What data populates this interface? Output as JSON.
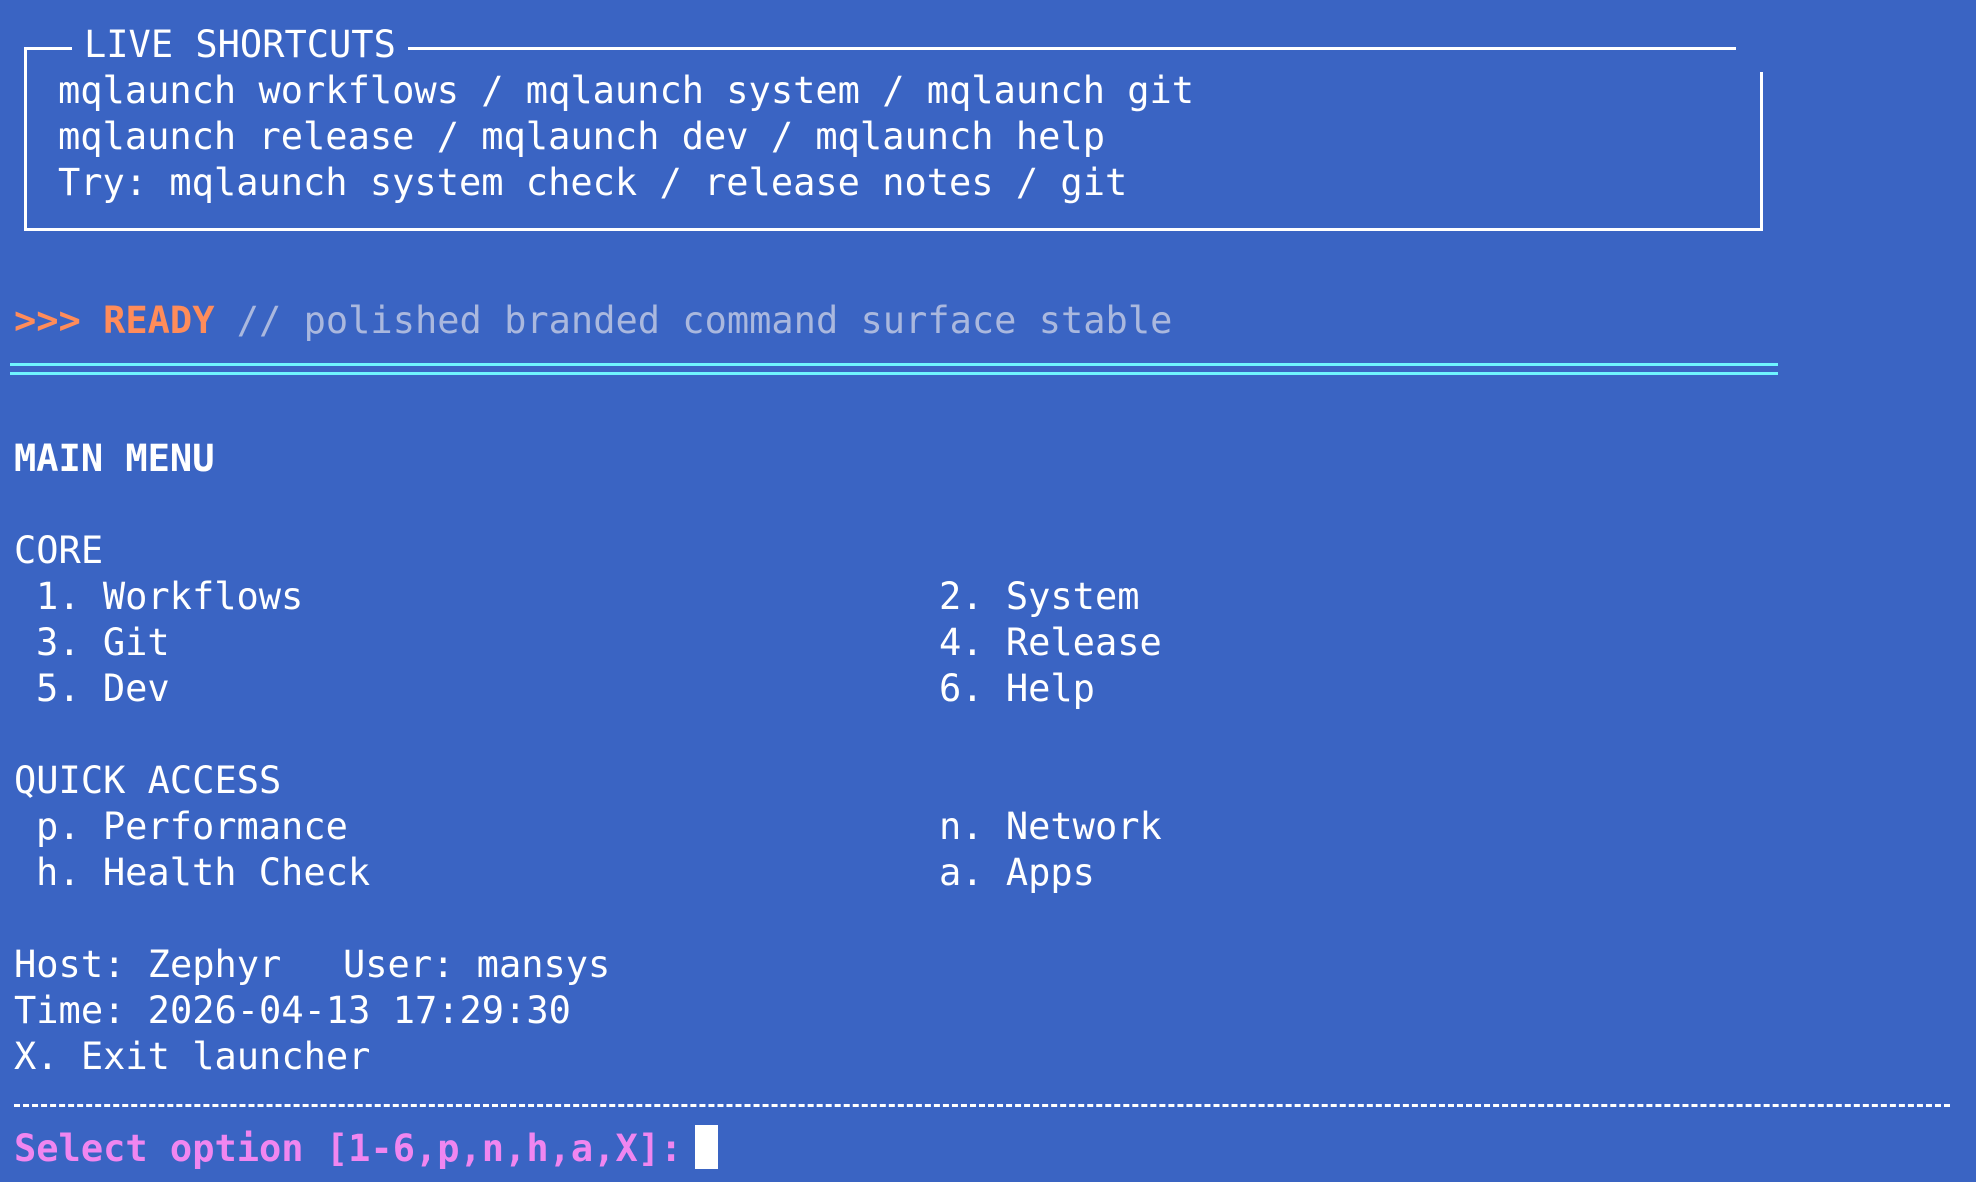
{
  "shortcuts": {
    "title": "LIVE SHORTCUTS",
    "line1": "mqlaunch workflows / mqlaunch system / mqlaunch git",
    "line2": "mqlaunch release / mqlaunch dev / mqlaunch help",
    "line3": "Try: mqlaunch system check / release notes / git"
  },
  "status": {
    "prompt": ">>>",
    "word": "READY",
    "message": "// polished branded command surface stable"
  },
  "menu": {
    "title": "MAIN MENU",
    "core": {
      "heading": "CORE",
      "items": [
        {
          "key": "1.",
          "label": "Workflows"
        },
        {
          "key": "2.",
          "label": "System"
        },
        {
          "key": "3.",
          "label": "Git"
        },
        {
          "key": "4.",
          "label": "Release"
        },
        {
          "key": "5.",
          "label": "Dev"
        },
        {
          "key": "6.",
          "label": "Help"
        }
      ]
    },
    "quick": {
      "heading": "QUICK ACCESS",
      "items": [
        {
          "key": "p.",
          "label": "Performance"
        },
        {
          "key": "n.",
          "label": "Network"
        },
        {
          "key": "h.",
          "label": "Health Check"
        },
        {
          "key": "a.",
          "label": "Apps"
        }
      ]
    }
  },
  "info": {
    "host_label": "Host:",
    "host": "Zephyr",
    "user_label": "User:",
    "user": "mansys",
    "time_label": "Time:",
    "time": "2026-04-13 17:29:30",
    "exit_key": "X.",
    "exit_label": "Exit launcher"
  },
  "prompt": {
    "text": "Select option [1-6,p,n,h,a,X]:"
  },
  "colors": {
    "background": "#3a64c3",
    "ready": "#ff8c5a",
    "muted": "#aab8de",
    "rule": "#6ff4ff",
    "prompt": "#f086f0"
  }
}
